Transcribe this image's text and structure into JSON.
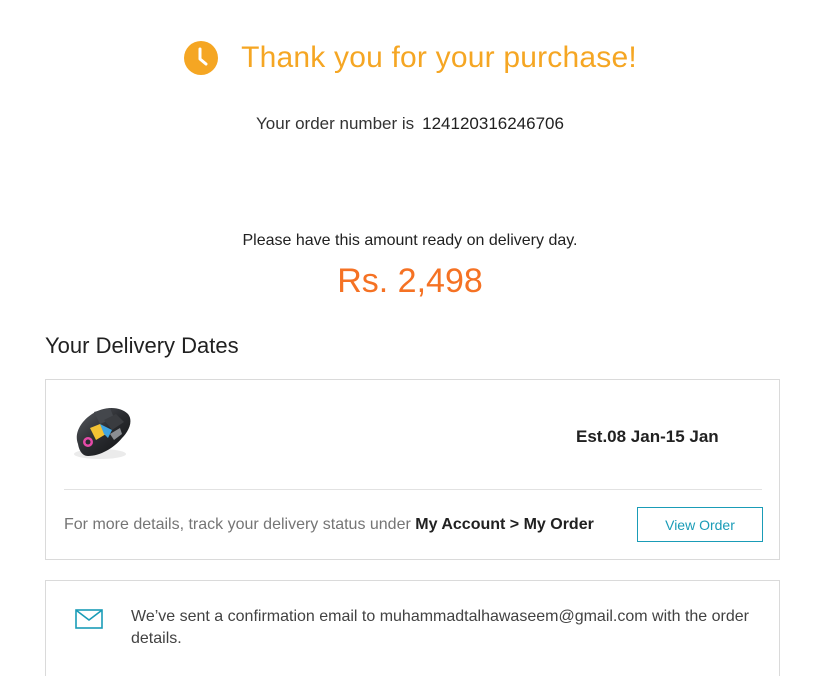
{
  "header": {
    "title": "Thank you for your purchase!",
    "icon": "clock-icon",
    "accent_color": "#f5a623"
  },
  "order": {
    "label": "Your order number is",
    "number": "124120316246706"
  },
  "payment": {
    "prompt": "Please have this amount ready on delivery day.",
    "amount": "Rs. 2,498",
    "amount_color": "#f57224"
  },
  "delivery": {
    "heading": "Your Delivery Dates",
    "product_icon": "gaming-mouse-image",
    "estimate": "Est.08 Jan-15 Jan",
    "track_prefix": "For more details, track your delivery status under",
    "track_path": "My Account > My Order",
    "view_order_label": "View Order",
    "link_color": "#1a9cb7"
  },
  "email_notice": {
    "icon": "mail-icon",
    "text": "We’ve sent a confirmation email to muhammadtalhawaseem@gmail.com with the order details."
  }
}
